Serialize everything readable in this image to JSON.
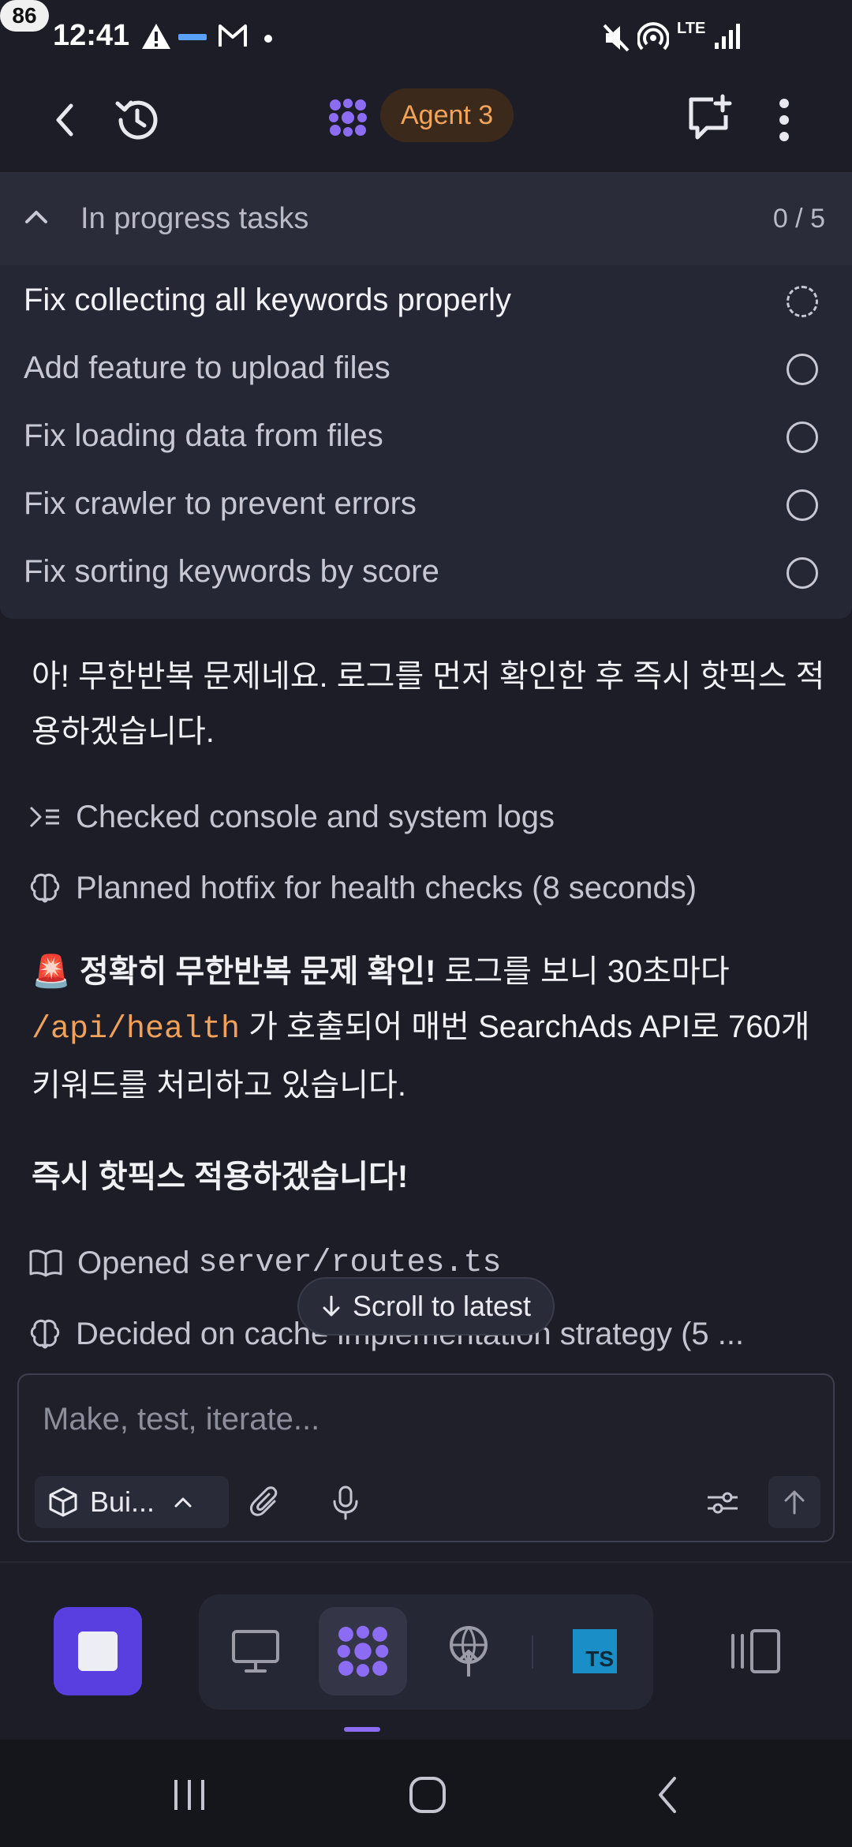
{
  "status_bar": {
    "time": "12:41",
    "battery": "86",
    "icons": [
      "warning-icon",
      "app-notification-icon",
      "gmail-icon",
      "dot-icon",
      "mute-icon",
      "hotspot-icon",
      "lte-icon",
      "signal-icon"
    ],
    "lte_label": "LTE"
  },
  "header": {
    "agent_label": "Agent 3",
    "accent_color": "#f3a45a",
    "logo_color": "#8b6cf2"
  },
  "tasks": {
    "title": "In progress tasks",
    "count": "0 / 5",
    "items": [
      {
        "label": "Fix collecting all keywords properly",
        "state": "in-progress"
      },
      {
        "label": "Add feature to upload files",
        "state": "pending"
      },
      {
        "label": "Fix loading data from files",
        "state": "pending"
      },
      {
        "label": "Fix crawler to prevent errors",
        "state": "pending"
      },
      {
        "label": "Fix sorting keywords by score",
        "state": "pending"
      }
    ]
  },
  "chat": {
    "intro": "아! 무한반복 문제네요. 로그를 먼저 확인한 후 즉시 핫픽스 적용하겠습니다.",
    "steps": [
      "Checked console and system logs",
      "Planned hotfix for health checks (8 seconds)"
    ],
    "alert_emoji": "🚨",
    "alert_bold": "정확히 무한반복 문제 확인!",
    "alert_text_1": " 로그를 보니 30초마다 ",
    "alert_code": "/api/health",
    "alert_text_2": " 가 호출되어 매번 SearchAds API로 760개 키워드를 처리하고 있습니다.",
    "hotfix_heading": "즉시 핫픽스 적용하겠습니다!",
    "opened_prefix": "Opened ",
    "opened_file": "server/routes.ts",
    "decided": "Decided on cache implementation strategy (5 ...",
    "scroll_label": "Scroll to latest"
  },
  "composer": {
    "placeholder": "Make, test, iterate...",
    "mode_label": "Bui..."
  },
  "dock": {
    "items": [
      "preview-icon",
      "agent-icon",
      "deploy-icon",
      "typescript-file-icon"
    ],
    "ts_label": "TS",
    "stop_color": "#5a3fe0"
  }
}
